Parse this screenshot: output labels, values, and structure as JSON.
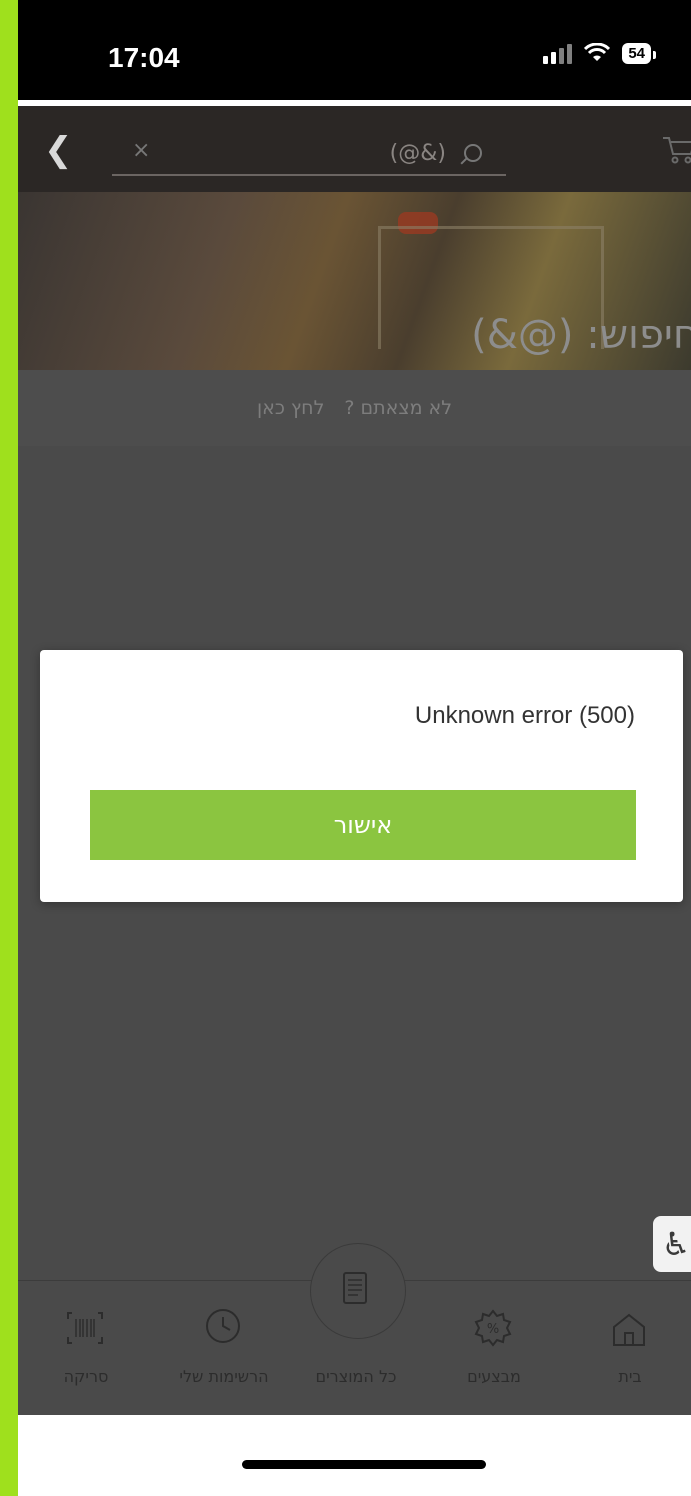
{
  "status_bar": {
    "time": "17:04",
    "battery": "54"
  },
  "search": {
    "value": "(@&)"
  },
  "banner": {
    "title": "חיפוש: (@&)"
  },
  "not_found": {
    "question": "לא מצאתם ?",
    "link": "לחץ כאן"
  },
  "dialog": {
    "message": "Unknown error (500)",
    "ok_label": "אישור"
  },
  "nav": {
    "scan": "סריקה",
    "my_lists": "הרשימות שלי",
    "all_products": "כל המוצרים",
    "deals": "מבצעים",
    "home": "בית"
  },
  "colors": {
    "accent_green": "#8bc540",
    "frame_green": "#9fe01d"
  }
}
